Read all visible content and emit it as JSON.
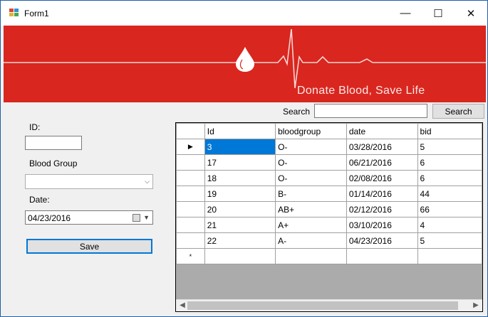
{
  "window": {
    "title": "Form1",
    "minimize_glyph": "—",
    "maximize_glyph": "☐",
    "close_glyph": "✕"
  },
  "banner": {
    "slogan": "Donate Blood, Save Life",
    "background": "#d9261f",
    "icon": "blood-drop-heartbeat-icon"
  },
  "form": {
    "id_label": "ID:",
    "id_value": "",
    "blood_group_label": "Blood Group",
    "blood_group_value": "",
    "date_label": "Date:",
    "date_value": "04/23/2016",
    "save_label": "Save"
  },
  "search": {
    "label": "Search",
    "value": "",
    "button_label": "Search"
  },
  "grid": {
    "columns": [
      "Id",
      "bloodgroup",
      "date",
      "bid"
    ],
    "rows": [
      [
        "3",
        "O-",
        "03/28/2016",
        "5"
      ],
      [
        "17",
        "O-",
        "06/21/2016",
        "6"
      ],
      [
        "18",
        "O-",
        "02/08/2016",
        "6"
      ],
      [
        "19",
        "B-",
        "01/14/2016",
        "44"
      ],
      [
        "20",
        "AB+",
        "02/12/2016",
        "66"
      ],
      [
        "21",
        "A+",
        "03/10/2016",
        "4"
      ],
      [
        "22",
        "A-",
        "04/23/2016",
        "5"
      ]
    ],
    "current_row_indicator": "▶",
    "new_row_indicator": "*",
    "selection_color": "#0078d7"
  }
}
